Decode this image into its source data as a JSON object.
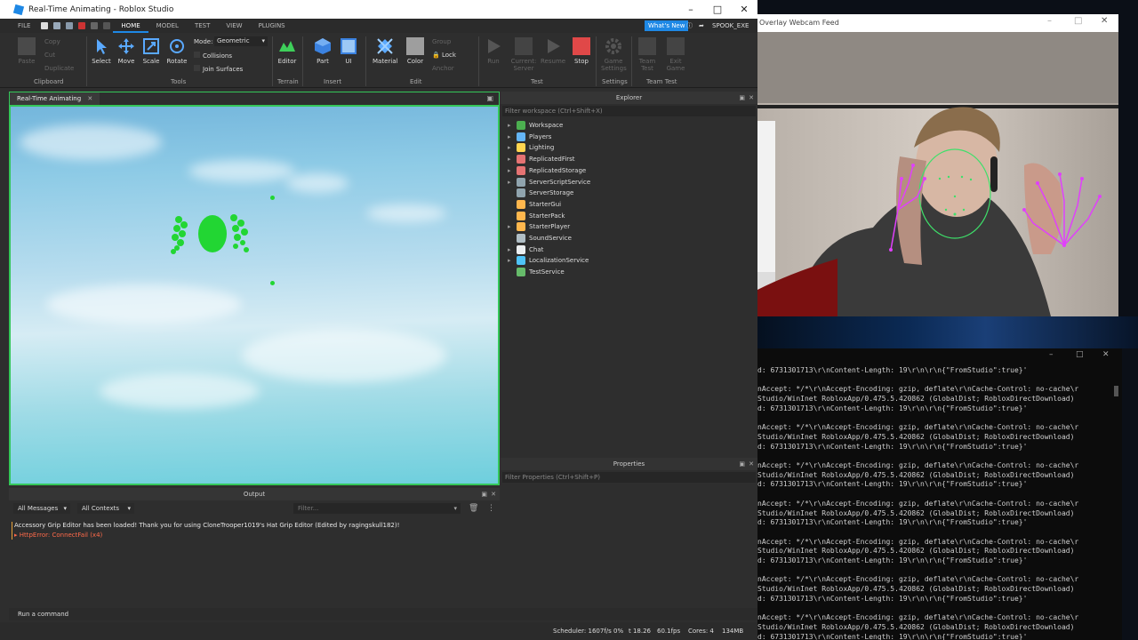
{
  "studio": {
    "title": "Real-Time Animating - Roblox Studio",
    "menus": [
      "FILE",
      "HOME",
      "MODEL",
      "TEST",
      "VIEW",
      "PLUGINS"
    ],
    "whats_new": "What's New",
    "user": "SPOOK_EXE",
    "ribbon": {
      "clipboard": {
        "paste": "Paste",
        "copy": "Copy",
        "cut": "Cut",
        "duplicate": "Duplicate",
        "group": "Clipboard"
      },
      "tools": {
        "select": "Select",
        "move": "Move",
        "scale": "Scale",
        "rotate": "Rotate",
        "group": "Tools"
      },
      "mode_label": "Mode:",
      "mode_value": "Geometric",
      "collisions": "Collisions",
      "join_surfaces": "Join Surfaces",
      "terrain": {
        "editor": "Editor",
        "group": "Terrain"
      },
      "insert": {
        "part": "Part",
        "ui": "UI",
        "group": "Insert"
      },
      "edit": {
        "material": "Material",
        "color": "Color",
        "group_btn": "Group",
        "lock": "Lock",
        "anchor": "Anchor",
        "group": "Edit"
      },
      "test": {
        "run": "Run",
        "current_server": "Current: Server",
        "resume": "Resume",
        "stop": "Stop",
        "group": "Test"
      },
      "settings": {
        "game_settings": "Game Settings",
        "group": "Settings"
      },
      "team_test": {
        "team_test": "Team Test",
        "exit_game": "Exit Game",
        "group": "Team Test"
      }
    },
    "viewport_tab": "Real-Time Animating",
    "explorer": {
      "title": "Explorer",
      "filter_placeholder": "Filter workspace (Ctrl+Shift+X)",
      "items": [
        {
          "label": "Workspace",
          "expandable": true,
          "color": "#4caf50"
        },
        {
          "label": "Players",
          "expandable": true,
          "color": "#64b5f6"
        },
        {
          "label": "Lighting",
          "expandable": true,
          "color": "#ffd54f"
        },
        {
          "label": "ReplicatedFirst",
          "expandable": true,
          "color": "#e57373"
        },
        {
          "label": "ReplicatedStorage",
          "expandable": true,
          "color": "#e57373"
        },
        {
          "label": "ServerScriptService",
          "expandable": true,
          "color": "#90a4ae"
        },
        {
          "label": "ServerStorage",
          "expandable": false,
          "color": "#90a4ae"
        },
        {
          "label": "StarterGui",
          "expandable": false,
          "color": "#ffb74d"
        },
        {
          "label": "StarterPack",
          "expandable": false,
          "color": "#ffb74d"
        },
        {
          "label": "StarterPlayer",
          "expandable": true,
          "color": "#ffb74d"
        },
        {
          "label": "SoundService",
          "expandable": false,
          "color": "#b0bec5"
        },
        {
          "label": "Chat",
          "expandable": true,
          "color": "#eceff1"
        },
        {
          "label": "LocalizationService",
          "expandable": true,
          "color": "#4fc3f7"
        },
        {
          "label": "TestService",
          "expandable": false,
          "color": "#66bb6a"
        }
      ]
    },
    "properties": {
      "title": "Properties",
      "filter_placeholder": "Filter Properties (Ctrl+Shift+P)"
    },
    "output": {
      "title": "Output",
      "messages_filter": "All Messages",
      "contexts_filter": "All Contexts",
      "filter_placeholder": "Filter...",
      "lines": [
        {
          "text": "Accessory Grip Editor has been loaded! Thank you for using CloneTrooper1019's Hat Grip Editor (Edited by ragingskull182)!",
          "color": "#e8e8e8"
        },
        {
          "text": "▸ HttpError: ConnectFail (x4)",
          "color": "#ff6a4a"
        }
      ]
    },
    "command_placeholder": "Run a command",
    "status": {
      "scheduler": "Scheduler: 1607f/s 0%",
      "t": "t 18.26",
      "fps": "60.1fps",
      "cores": "Cores: 4",
      "mem": "134MB"
    }
  },
  "webcam": {
    "title": "Overlay Webcam Feed"
  },
  "console": {
    "lines": [
      "d: 6731301713\\r\\nContent-Length: 19\\r\\n\\r\\n{\"FromStudio\":true}'",
      "",
      "nAccept: */*\\r\\nAccept-Encoding: gzip, deflate\\r\\nCache-Control: no-cache\\r",
      "Studio/WinInet RobloxApp/0.475.5.420862 (GlobalDist; RobloxDirectDownload)",
      "d: 6731301713\\r\\nContent-Length: 19\\r\\n\\r\\n{\"FromStudio\":true}'",
      "",
      "nAccept: */*\\r\\nAccept-Encoding: gzip, deflate\\r\\nCache-Control: no-cache\\r",
      "Studio/WinInet RobloxApp/0.475.5.420862 (GlobalDist; RobloxDirectDownload)",
      "d: 6731301713\\r\\nContent-Length: 19\\r\\n\\r\\n{\"FromStudio\":true}'",
      "",
      "nAccept: */*\\r\\nAccept-Encoding: gzip, deflate\\r\\nCache-Control: no-cache\\r",
      "Studio/WinInet RobloxApp/0.475.5.420862 (GlobalDist; RobloxDirectDownload)",
      "d: 6731301713\\r\\nContent-Length: 19\\r\\n\\r\\n{\"FromStudio\":true}'",
      "",
      "nAccept: */*\\r\\nAccept-Encoding: gzip, deflate\\r\\nCache-Control: no-cache\\r",
      "Studio/WinInet RobloxApp/0.475.5.420862 (GlobalDist; RobloxDirectDownload)",
      "d: 6731301713\\r\\nContent-Length: 19\\r\\n\\r\\n{\"FromStudio\":true}'",
      "",
      "nAccept: */*\\r\\nAccept-Encoding: gzip, deflate\\r\\nCache-Control: no-cache\\r",
      "Studio/WinInet RobloxApp/0.475.5.420862 (GlobalDist; RobloxDirectDownload)",
      "d: 6731301713\\r\\nContent-Length: 19\\r\\n\\r\\n{\"FromStudio\":true}'",
      "",
      "nAccept: */*\\r\\nAccept-Encoding: gzip, deflate\\r\\nCache-Control: no-cache\\r",
      "Studio/WinInet RobloxApp/0.475.5.420862 (GlobalDist; RobloxDirectDownload)",
      "d: 6731301713\\r\\nContent-Length: 19\\r\\n\\r\\n{\"FromStudio\":true}'",
      "",
      "nAccept: */*\\r\\nAccept-Encoding: gzip, deflate\\r\\nCache-Control: no-cache\\r",
      "Studio/WinInet RobloxApp/0.475.5.420862 (GlobalDist; RobloxDirectDownload)",
      "d: 6731301713\\r\\nContent-Length: 19\\r\\n\\r\\n{\"FromStudio\":true}'"
    ]
  }
}
